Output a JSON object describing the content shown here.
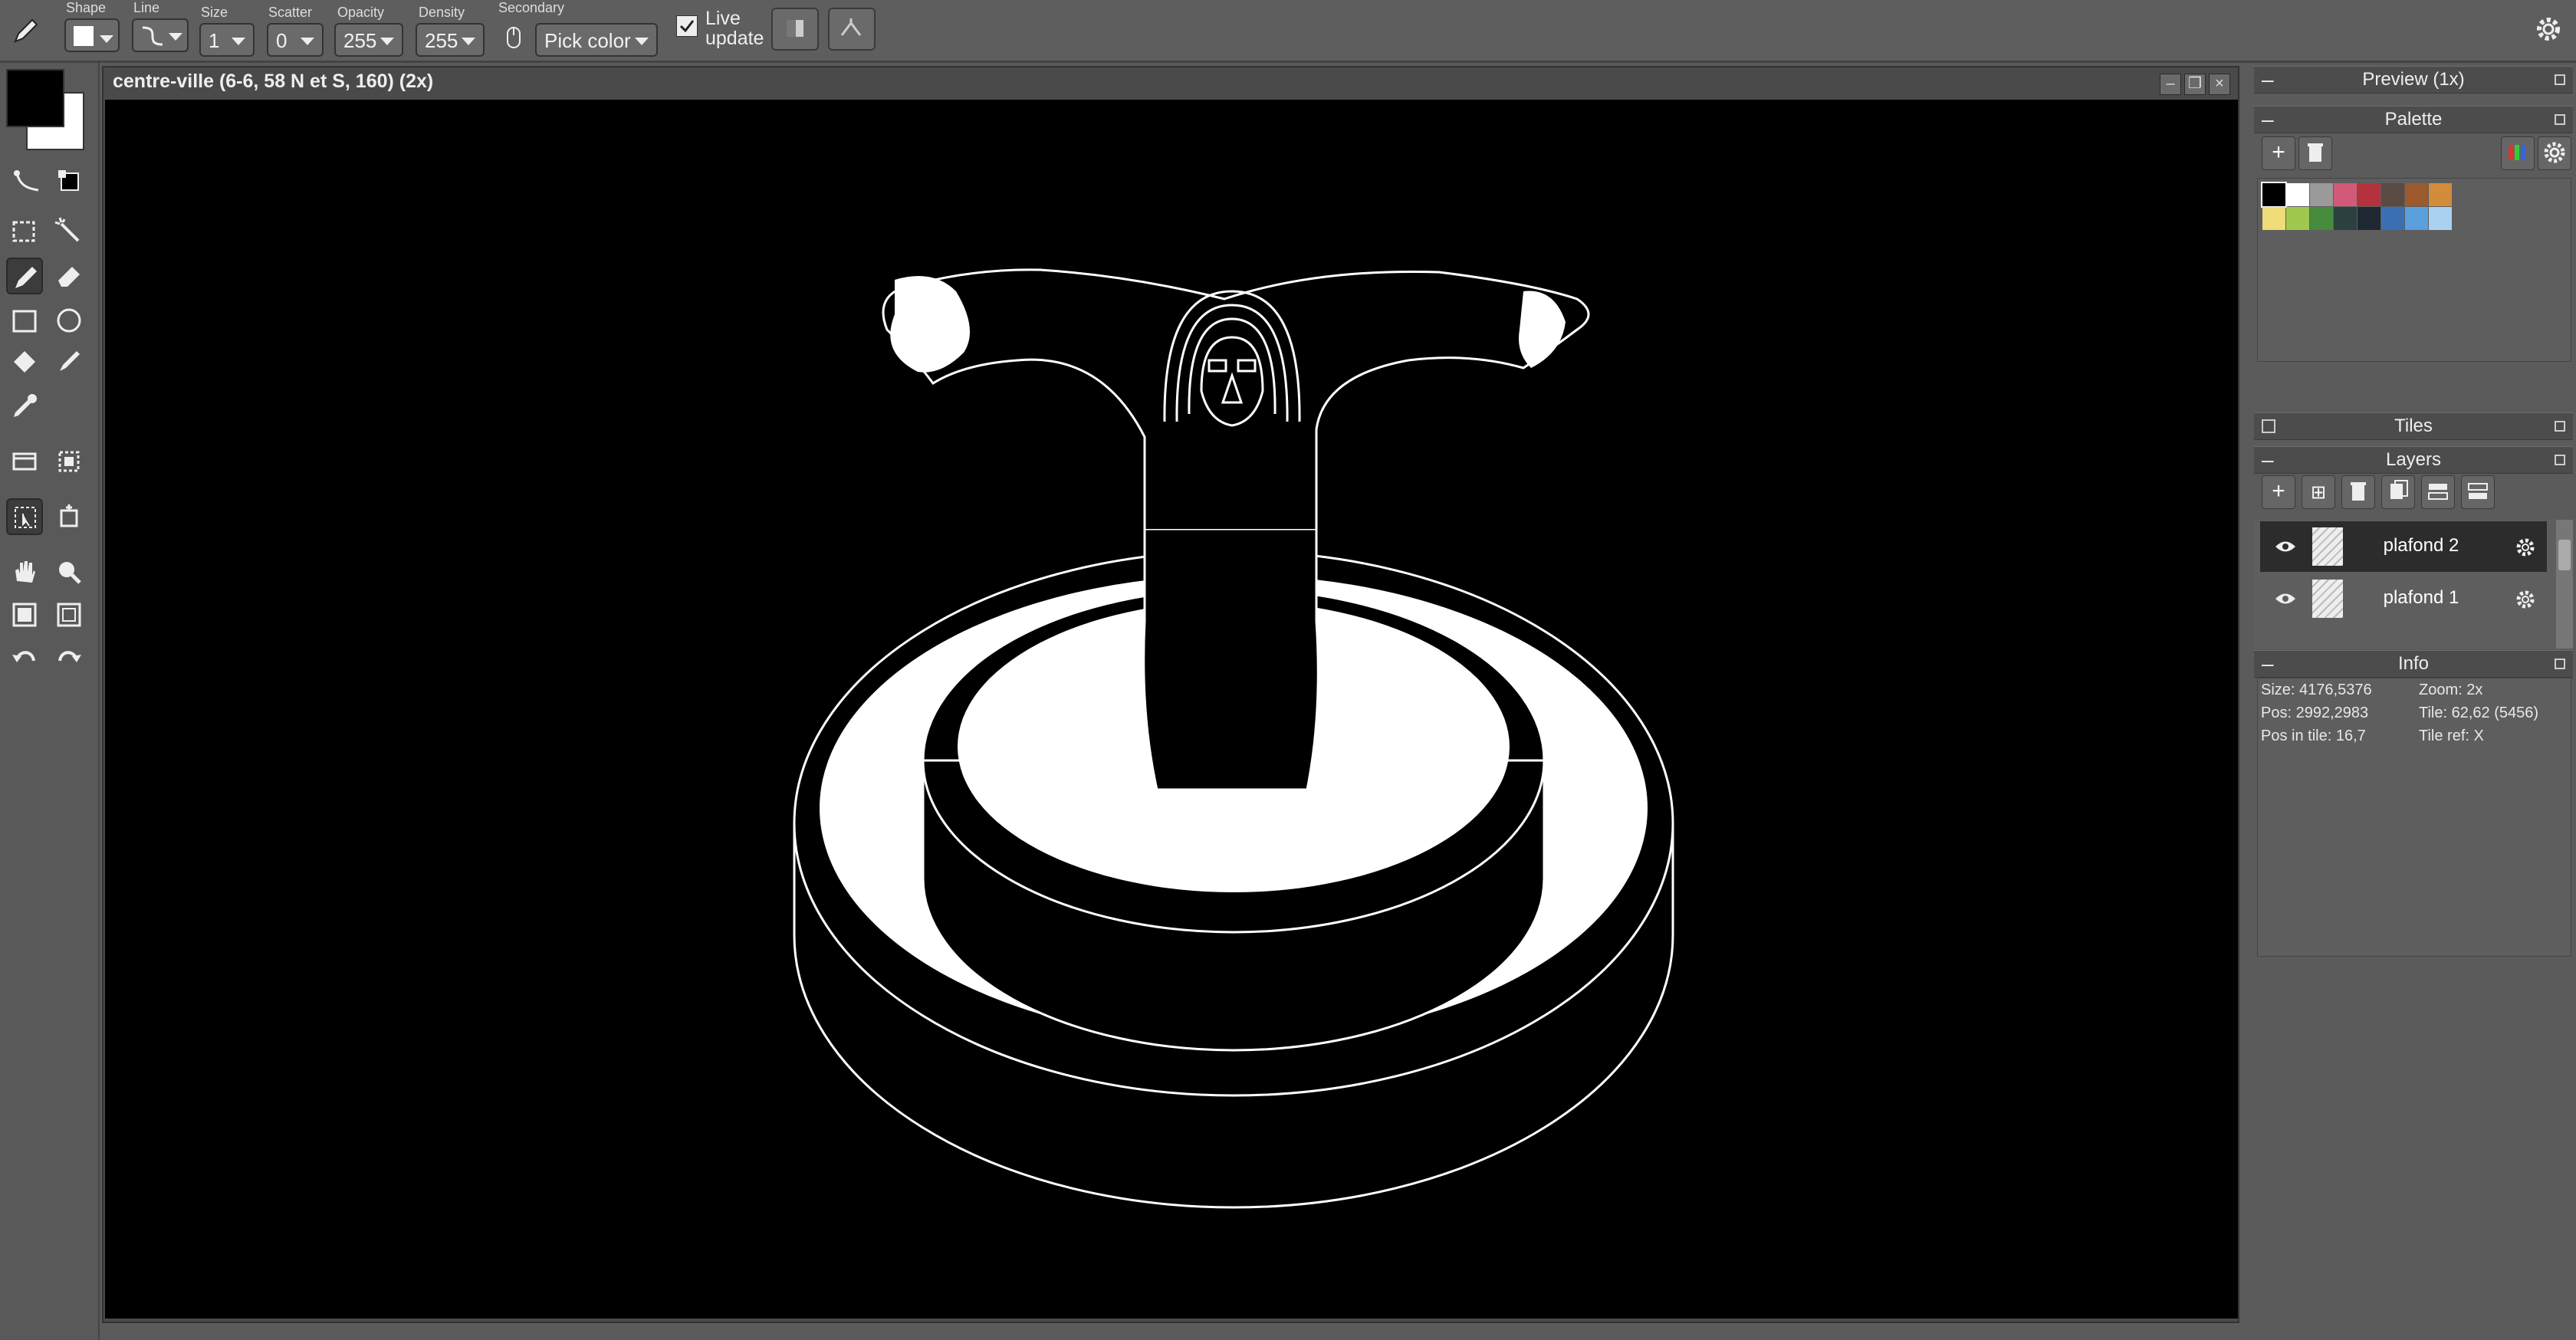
{
  "toolbar": {
    "shape_label": "Shape",
    "line_label": "Line",
    "size_label": "Size",
    "size_value": "1",
    "scatter_label": "Scatter",
    "scatter_value": "0",
    "opacity_label": "Opacity",
    "opacity_value": "255",
    "density_label": "Density",
    "density_value": "255",
    "secondary_label": "Secondary",
    "secondary_value": "Pick color",
    "live_update_line1": "Live",
    "live_update_line2": "update",
    "live_update_checked": true
  },
  "colors": {
    "primary": "#000000",
    "secondary": "#ffffff",
    "accent": "#ffffff"
  },
  "tools": [
    "line-tool-icon",
    "swap-colors-icon",
    "rect-select-icon",
    "magic-wand-icon",
    "pencil-icon",
    "eraser-icon",
    "rectangle-icon",
    "ellipse-icon",
    "fill-icon",
    "brush-icon",
    "eyedropper-icon",
    "layer-tool-icon",
    "transform-icon",
    "move-icon",
    "selection-icon",
    "hand-icon",
    "zoom-icon",
    "grid-icon",
    "frame-icon",
    "undo-icon",
    "redo-icon"
  ],
  "document": {
    "title": "centre-ville (6-6, 58 N et S, 160)   (2x)"
  },
  "panels": {
    "preview": "Preview (1x)",
    "palette": "Palette",
    "tiles": "Tiles",
    "layers": "Layers",
    "info": "Info"
  },
  "palette_colors": [
    "#000000",
    "#ffffff",
    "#9a9a9a",
    "#d25a78",
    "#b3323c",
    "#5a4a44",
    "#9c5a2c",
    "#d28c3c",
    "#f0dc78",
    "#a0c850",
    "#468c3c",
    "#2c4040",
    "#1e2832",
    "#3c6eb4",
    "#5aa0dc",
    "#aad2f0"
  ],
  "layers": [
    {
      "name": "plafond 2",
      "visible": true,
      "selected": true
    },
    {
      "name": "plafond 1",
      "visible": true,
      "selected": false
    }
  ],
  "info": {
    "size": "Size: 4176,5376",
    "zoom": "Zoom: 2x",
    "pos": "Pos: 2992,2983",
    "tile": "Tile: 62,62 (5456)",
    "pos_in_tile": "Pos in tile: 16,7",
    "tile_ref": "Tile ref: X"
  }
}
